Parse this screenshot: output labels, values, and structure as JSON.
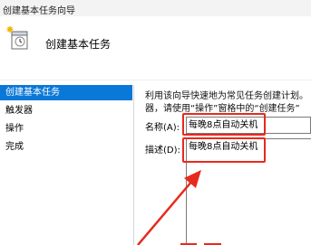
{
  "window": {
    "title": "创建基本任务向导"
  },
  "header": {
    "title": "创建基本任务",
    "icon": "scheduled-task-icon"
  },
  "sidebar": {
    "items": [
      {
        "label": "创建基本任务",
        "active": true
      },
      {
        "label": "触发器",
        "active": false
      },
      {
        "label": "操作",
        "active": false
      },
      {
        "label": "完成",
        "active": false
      }
    ]
  },
  "main": {
    "description_line1": "利用该向导快速地为常见任务创建计划。",
    "description_line2": "器，请使用“操作”窗格中的“创建任务”",
    "name_label": "名称(A):",
    "name_value": "每晚8点自动关机",
    "desc_label": "描述(D):",
    "desc_value": "每晚8点自动关机"
  },
  "annotation": {
    "color": "#e62a1e"
  }
}
